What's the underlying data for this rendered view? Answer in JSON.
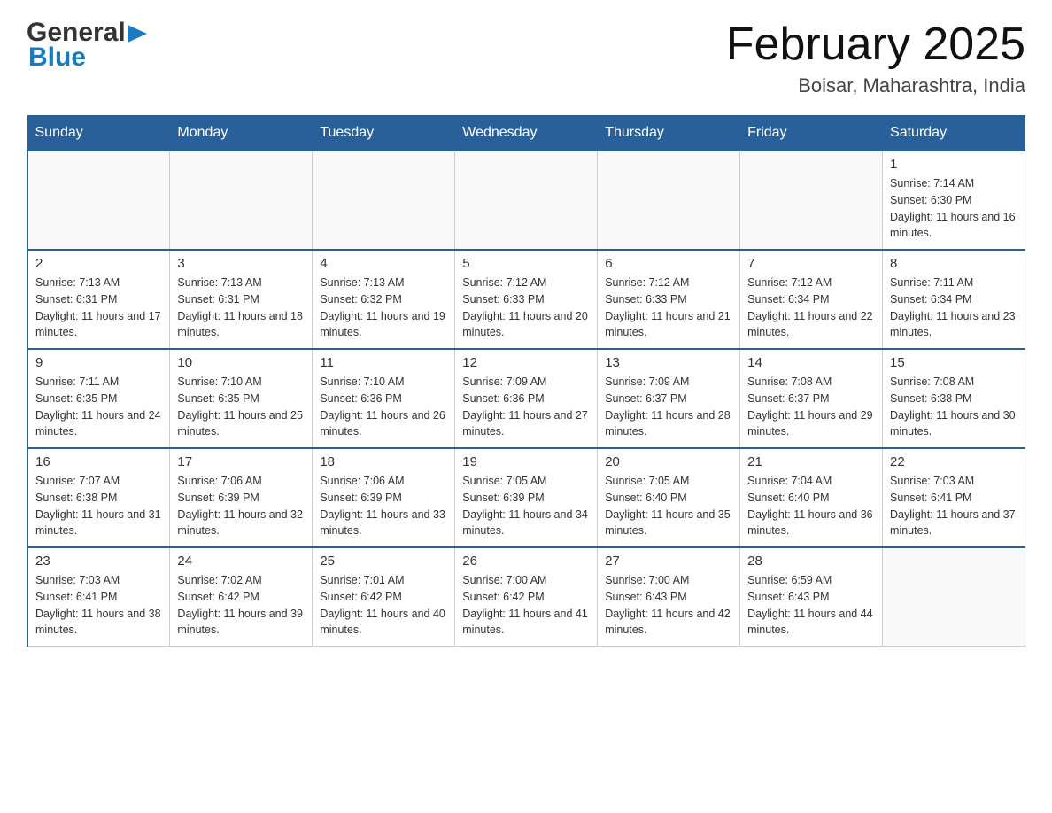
{
  "header": {
    "logo": {
      "general": "General",
      "blue": "Blue",
      "arrow": "▶"
    },
    "title": "February 2025",
    "location": "Boisar, Maharashtra, India"
  },
  "days_of_week": [
    "Sunday",
    "Monday",
    "Tuesday",
    "Wednesday",
    "Thursday",
    "Friday",
    "Saturday"
  ],
  "weeks": [
    [
      {
        "day": "",
        "info": ""
      },
      {
        "day": "",
        "info": ""
      },
      {
        "day": "",
        "info": ""
      },
      {
        "day": "",
        "info": ""
      },
      {
        "day": "",
        "info": ""
      },
      {
        "day": "",
        "info": ""
      },
      {
        "day": "1",
        "info": "Sunrise: 7:14 AM\nSunset: 6:30 PM\nDaylight: 11 hours and 16 minutes."
      }
    ],
    [
      {
        "day": "2",
        "info": "Sunrise: 7:13 AM\nSunset: 6:31 PM\nDaylight: 11 hours and 17 minutes."
      },
      {
        "day": "3",
        "info": "Sunrise: 7:13 AM\nSunset: 6:31 PM\nDaylight: 11 hours and 18 minutes."
      },
      {
        "day": "4",
        "info": "Sunrise: 7:13 AM\nSunset: 6:32 PM\nDaylight: 11 hours and 19 minutes."
      },
      {
        "day": "5",
        "info": "Sunrise: 7:12 AM\nSunset: 6:33 PM\nDaylight: 11 hours and 20 minutes."
      },
      {
        "day": "6",
        "info": "Sunrise: 7:12 AM\nSunset: 6:33 PM\nDaylight: 11 hours and 21 minutes."
      },
      {
        "day": "7",
        "info": "Sunrise: 7:12 AM\nSunset: 6:34 PM\nDaylight: 11 hours and 22 minutes."
      },
      {
        "day": "8",
        "info": "Sunrise: 7:11 AM\nSunset: 6:34 PM\nDaylight: 11 hours and 23 minutes."
      }
    ],
    [
      {
        "day": "9",
        "info": "Sunrise: 7:11 AM\nSunset: 6:35 PM\nDaylight: 11 hours and 24 minutes."
      },
      {
        "day": "10",
        "info": "Sunrise: 7:10 AM\nSunset: 6:35 PM\nDaylight: 11 hours and 25 minutes."
      },
      {
        "day": "11",
        "info": "Sunrise: 7:10 AM\nSunset: 6:36 PM\nDaylight: 11 hours and 26 minutes."
      },
      {
        "day": "12",
        "info": "Sunrise: 7:09 AM\nSunset: 6:36 PM\nDaylight: 11 hours and 27 minutes."
      },
      {
        "day": "13",
        "info": "Sunrise: 7:09 AM\nSunset: 6:37 PM\nDaylight: 11 hours and 28 minutes."
      },
      {
        "day": "14",
        "info": "Sunrise: 7:08 AM\nSunset: 6:37 PM\nDaylight: 11 hours and 29 minutes."
      },
      {
        "day": "15",
        "info": "Sunrise: 7:08 AM\nSunset: 6:38 PM\nDaylight: 11 hours and 30 minutes."
      }
    ],
    [
      {
        "day": "16",
        "info": "Sunrise: 7:07 AM\nSunset: 6:38 PM\nDaylight: 11 hours and 31 minutes."
      },
      {
        "day": "17",
        "info": "Sunrise: 7:06 AM\nSunset: 6:39 PM\nDaylight: 11 hours and 32 minutes."
      },
      {
        "day": "18",
        "info": "Sunrise: 7:06 AM\nSunset: 6:39 PM\nDaylight: 11 hours and 33 minutes."
      },
      {
        "day": "19",
        "info": "Sunrise: 7:05 AM\nSunset: 6:39 PM\nDaylight: 11 hours and 34 minutes."
      },
      {
        "day": "20",
        "info": "Sunrise: 7:05 AM\nSunset: 6:40 PM\nDaylight: 11 hours and 35 minutes."
      },
      {
        "day": "21",
        "info": "Sunrise: 7:04 AM\nSunset: 6:40 PM\nDaylight: 11 hours and 36 minutes."
      },
      {
        "day": "22",
        "info": "Sunrise: 7:03 AM\nSunset: 6:41 PM\nDaylight: 11 hours and 37 minutes."
      }
    ],
    [
      {
        "day": "23",
        "info": "Sunrise: 7:03 AM\nSunset: 6:41 PM\nDaylight: 11 hours and 38 minutes."
      },
      {
        "day": "24",
        "info": "Sunrise: 7:02 AM\nSunset: 6:42 PM\nDaylight: 11 hours and 39 minutes."
      },
      {
        "day": "25",
        "info": "Sunrise: 7:01 AM\nSunset: 6:42 PM\nDaylight: 11 hours and 40 minutes."
      },
      {
        "day": "26",
        "info": "Sunrise: 7:00 AM\nSunset: 6:42 PM\nDaylight: 11 hours and 41 minutes."
      },
      {
        "day": "27",
        "info": "Sunrise: 7:00 AM\nSunset: 6:43 PM\nDaylight: 11 hours and 42 minutes."
      },
      {
        "day": "28",
        "info": "Sunrise: 6:59 AM\nSunset: 6:43 PM\nDaylight: 11 hours and 44 minutes."
      },
      {
        "day": "",
        "info": ""
      }
    ]
  ]
}
